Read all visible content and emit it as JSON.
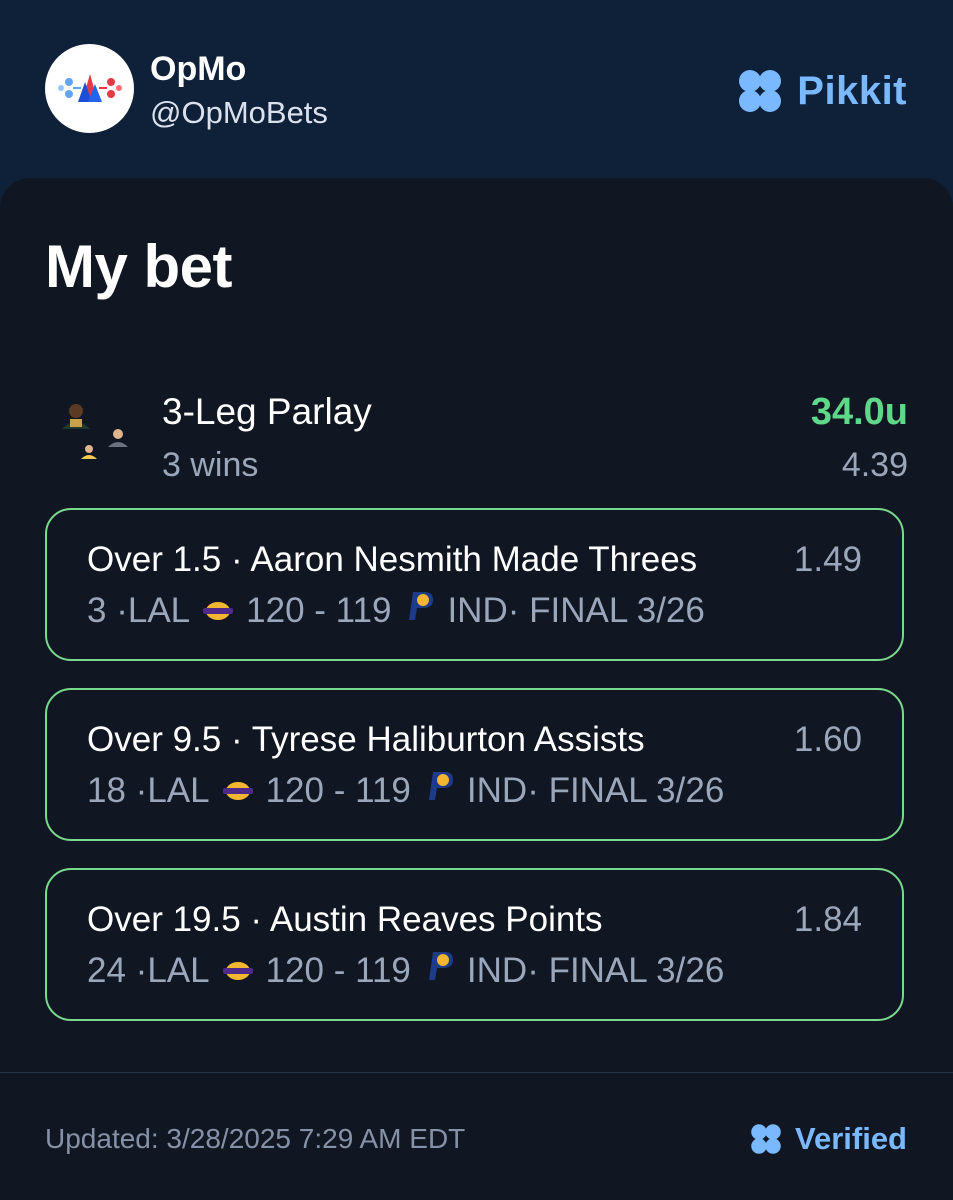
{
  "profile": {
    "name": "OpMo",
    "handle": "@OpMoBets"
  },
  "brand": {
    "name": "Pikkit",
    "color": "#7ab8ff"
  },
  "bet": {
    "heading": "My bet",
    "parlay": {
      "title": "3-Leg Parlay",
      "result": "3 wins",
      "units": "34.0u",
      "odds": "4.39"
    },
    "legs": [
      {
        "title": "Over 1.5 · Aaron Nesmith Made Threes",
        "odds": "1.49",
        "actual": "3 · ",
        "away": "LAL",
        "score": "120 - 119",
        "home": "IND",
        "status": " · FINAL 3/26"
      },
      {
        "title": "Over 9.5 · Tyrese Haliburton Assists",
        "odds": "1.60",
        "actual": "18 · ",
        "away": "LAL",
        "score": "120 - 119",
        "home": "IND",
        "status": " · FINAL 3/26"
      },
      {
        "title": "Over 19.5 · Austin Reaves Points",
        "odds": "1.84",
        "actual": "24 · ",
        "away": "LAL",
        "score": "120 - 119",
        "home": "IND",
        "status": " · FINAL 3/26"
      }
    ]
  },
  "footer": {
    "updated": "Updated: 3/28/2025 7:29 AM EDT",
    "verified": "Verified"
  },
  "colors": {
    "win_green": "#5fd88a",
    "leg_border": "#79d98c",
    "card_bg": "#111722",
    "header_bg": "#0f2039"
  },
  "icons": {
    "brand": "clover-icon",
    "avatar": "opmo-logo",
    "away_team": "lakers-logo",
    "home_team": "pacers-logo",
    "verified": "clover-icon"
  }
}
